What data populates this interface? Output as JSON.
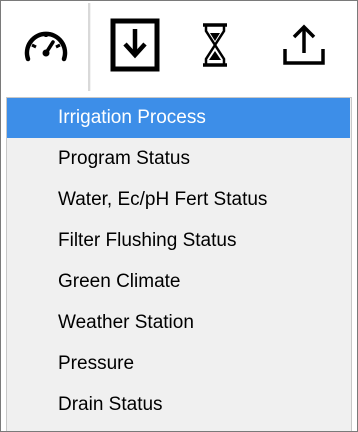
{
  "toolbar": {
    "buttons": [
      {
        "icon": "gauge-icon"
      },
      {
        "icon": "import-icon"
      },
      {
        "icon": "hourglass-icon"
      },
      {
        "icon": "upload-icon"
      }
    ]
  },
  "menu": {
    "selected_index": 0,
    "selected_color": "#3d8ee8",
    "items": [
      {
        "label": "Irrigation Process"
      },
      {
        "label": "Program Status"
      },
      {
        "label": "Water, Ec/pH Fert Status"
      },
      {
        "label": "Filter Flushing Status"
      },
      {
        "label": "Green Climate"
      },
      {
        "label": "Weather Station"
      },
      {
        "label": "Pressure"
      },
      {
        "label": "Drain Status"
      }
    ]
  }
}
